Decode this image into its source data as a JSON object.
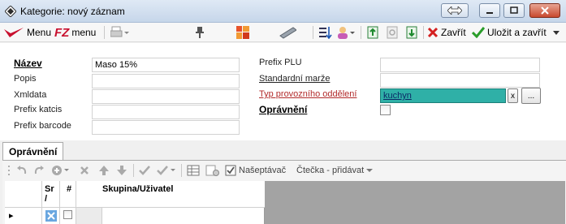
{
  "window": {
    "title": "Kategorie: nový záznam"
  },
  "toolbar": {
    "menu1_label": "Menu",
    "menu2_label": "menu",
    "close_label": "Zavřít",
    "save_close_label": "Uložit a zavřít"
  },
  "form": {
    "left": [
      {
        "label": "Název",
        "value": "Maso 15%"
      },
      {
        "label": "Popis",
        "value": ""
      },
      {
        "label": "Xmldata",
        "value": ""
      },
      {
        "label": "Prefix katcis",
        "value": ""
      },
      {
        "label": "Prefix barcode",
        "value": ""
      }
    ],
    "right": [
      {
        "label": "Prefix PLU",
        "value": ""
      },
      {
        "label": "Standardní marže",
        "value": ""
      },
      {
        "label": "Typ provozního oddělení",
        "value": "kuchyn",
        "clear_label": "x",
        "browse_label": "..."
      },
      {
        "label": "Oprávnění",
        "checked": false
      }
    ]
  },
  "tabs": [
    {
      "label": "Oprávnění",
      "active": true
    }
  ],
  "subtoolbar": {
    "suggest_label": "Našeptávač",
    "reader_label": "Čtečka - přidávat"
  },
  "grid": {
    "columns": [
      "Sr /",
      "#",
      "Skupina/Uživatel"
    ],
    "row_marker": "▸"
  },
  "colors": {
    "accent_teal": "#2fb0a7",
    "required_red": "#b22a2a",
    "save_green": "#2a9d2a",
    "close_red": "#d42020"
  }
}
